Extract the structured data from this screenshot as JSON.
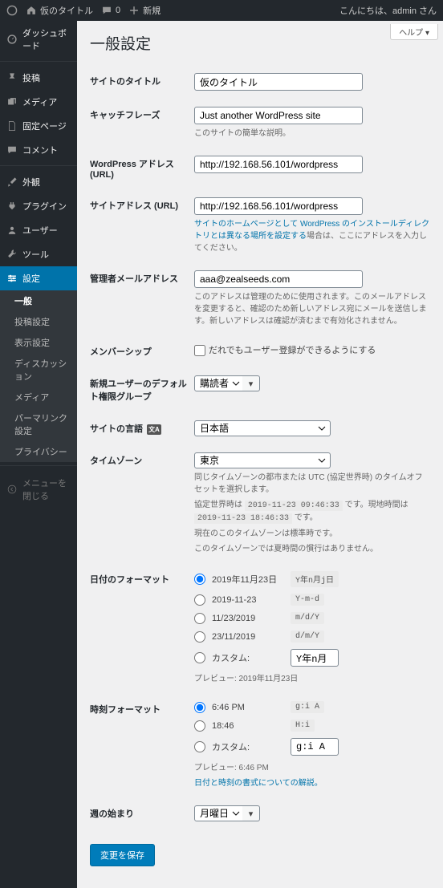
{
  "adminbar": {
    "site_title": "仮のタイトル",
    "comments": "0",
    "new": "新規",
    "greeting": "こんにちは、admin さん"
  },
  "help_tab": "ヘルプ ▾",
  "sidebar": {
    "dashboard": "ダッシュボード",
    "posts": "投稿",
    "media": "メディア",
    "pages": "固定ページ",
    "comments": "コメント",
    "appearance": "外観",
    "plugins": "プラグイン",
    "users": "ユーザー",
    "tools": "ツール",
    "settings": "設定",
    "sub": {
      "general": "一般",
      "writing": "投稿設定",
      "reading": "表示設定",
      "discussion": "ディスカッション",
      "media": "メディア",
      "permalink": "パーマリンク設定",
      "privacy": "プライバシー"
    },
    "collapse": "メニューを閉じる"
  },
  "page_title": "一般設定",
  "fields": {
    "site_title": {
      "label": "サイトのタイトル",
      "value": "仮のタイトル"
    },
    "tagline": {
      "label": "キャッチフレーズ",
      "value": "Just another WordPress site",
      "desc": "このサイトの簡単な説明。"
    },
    "wp_url": {
      "label": "WordPress アドレス (URL)",
      "value": "http://192.168.56.101/wordpress"
    },
    "site_url": {
      "label": "サイトアドレス (URL)",
      "value": "http://192.168.56.101/wordpress",
      "desc_link": "サイトのホームページとして WordPress のインストールディレクトリとは異なる場所を設定する",
      "desc_tail": "場合は、ここにアドレスを入力してください。"
    },
    "admin_email": {
      "label": "管理者メールアドレス",
      "value": "aaa@zealseeds.com",
      "desc": "このアドレスは管理のために使用されます。このメールアドレスを変更すると、確認のため新しいアドレス宛にメールを送信します。新しいアドレスは確認が済むまで有効化されません。"
    },
    "membership": {
      "label": "メンバーシップ",
      "checkbox": "だれでもユーザー登録ができるようにする"
    },
    "default_role": {
      "label": "新規ユーザーのデフォルト権限グループ",
      "value": "購読者"
    },
    "language": {
      "label": "サイトの言語",
      "value": "日本語"
    },
    "timezone": {
      "label": "タイムゾーン",
      "value": "東京",
      "desc1": "同じタイムゾーンの都市または UTC (協定世界時) のタイムオフセットを選択します。",
      "utc_label": "協定世界時は",
      "utc_time": "2019-11-23 09:46:33",
      "desc2": "です。現地時間は",
      "local_time": "2019-11-23 18:46:33",
      "desc3": "です。",
      "std1": "現在のこのタイムゾーンは標準時です。",
      "std2": "このタイムゾーンでは夏時間の慣行はありません。"
    },
    "date_format": {
      "label": "日付のフォーマット",
      "options": [
        {
          "text": "2019年11月23日",
          "code": "Y年n月j日",
          "checked": true
        },
        {
          "text": "2019-11-23",
          "code": "Y-m-d"
        },
        {
          "text": "11/23/2019",
          "code": "m/d/Y"
        },
        {
          "text": "23/11/2019",
          "code": "d/m/Y"
        }
      ],
      "custom_label": "カスタム:",
      "custom_value": "Y年n月",
      "preview_label": "プレビュー:",
      "preview_value": "2019年11月23日"
    },
    "time_format": {
      "label": "時刻フォーマット",
      "options": [
        {
          "text": "6:46 PM",
          "code": "g:i A",
          "checked": true
        },
        {
          "text": "18:46",
          "code": "H:i"
        }
      ],
      "custom_label": "カスタム:",
      "custom_value": "g:i A",
      "preview_label": "プレビュー:",
      "preview_value": "6:46 PM",
      "doc_link": "日付と時刻の書式についての解説。"
    },
    "week_start": {
      "label": "週の始まり",
      "value": "月曜日"
    }
  },
  "save_button": "変更を保存"
}
